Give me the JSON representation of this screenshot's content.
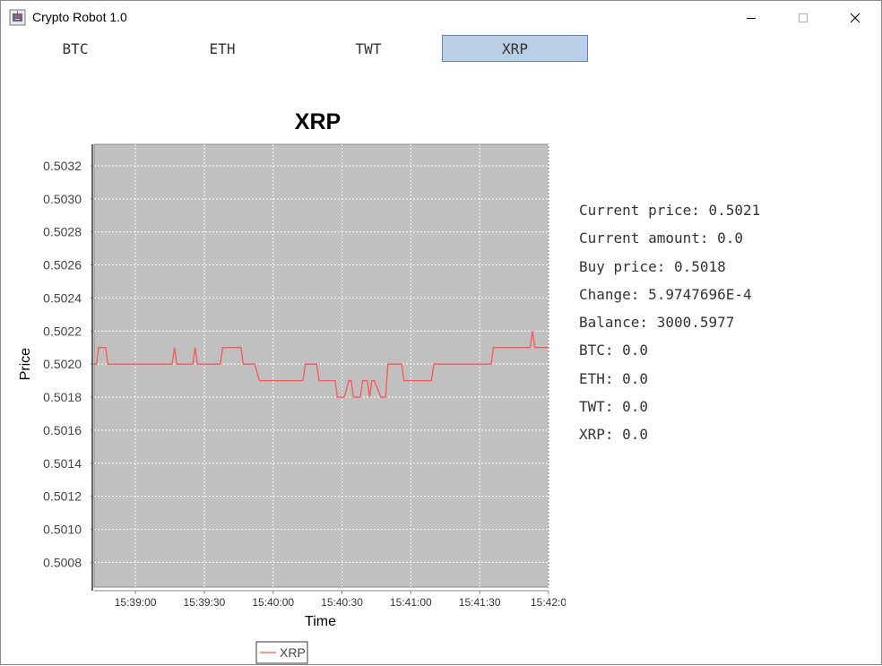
{
  "window": {
    "title": "Crypto Robot 1.0",
    "icon": "robot-app-icon",
    "controls": [
      "minimize-icon",
      "maximize-icon",
      "close-icon"
    ]
  },
  "tabs": [
    {
      "label": "BTC",
      "selected": false
    },
    {
      "label": "ETH",
      "selected": false
    },
    {
      "label": "TWT",
      "selected": false
    },
    {
      "label": "XRP",
      "selected": true
    }
  ],
  "info": {
    "current_price": "Current price: 0.5021",
    "current_amount": "Current amount: 0.0",
    "buy_price": "Buy price: 0.5018",
    "change": "Change: 5.9747696E-4",
    "balance": "Balance: 3000.5977",
    "btc": "BTC: 0.0",
    "eth": "ETH: 0.0",
    "twt": "TWT: 0.0",
    "xrp": "XRP: 0.0"
  },
  "colors": {
    "accent_tab_bg": "#b8cfe5",
    "accent_tab_border": "#6382bf",
    "plot_bg": "#c0c0c0",
    "series_line": "#ff5555"
  },
  "chart_data": {
    "type": "line",
    "title": "XRP",
    "xlabel": "Time",
    "ylabel": "Price",
    "ylim": [
      0.50065,
      0.50333
    ],
    "yticks": [
      "0.5032",
      "0.5030",
      "0.5028",
      "0.5026",
      "0.5024",
      "0.5022",
      "0.5020",
      "0.5018",
      "0.5016",
      "0.5014",
      "0.5012",
      "0.5010",
      "0.5008"
    ],
    "xticks": [
      "15:39:00",
      "15:39:30",
      "15:40:00",
      "15:40:30",
      "15:41:00",
      "15:41:30",
      "15:42:0"
    ],
    "x_tick_seconds": [
      0,
      30,
      60,
      90,
      120,
      150,
      180
    ],
    "xlim_seconds": [
      -18,
      180
    ],
    "grid": true,
    "legend": "bottom",
    "series": [
      {
        "name": "XRP",
        "x_seconds": [
          -18,
          -17,
          -16,
          -14,
          -13,
          -12,
          -6,
          0,
          6,
          15,
          16,
          17,
          18,
          22,
          25,
          26,
          27,
          36,
          37,
          38,
          42,
          46,
          47,
          51,
          52,
          54,
          55,
          62,
          63,
          73,
          74,
          79,
          80,
          83,
          84,
          87,
          88,
          89,
          90,
          91,
          93,
          94,
          95,
          97,
          98,
          99,
          100,
          101,
          102,
          103,
          104,
          107,
          108,
          109,
          110,
          111,
          116,
          117,
          122,
          124,
          129,
          130,
          136,
          140,
          150,
          155,
          156,
          168,
          172,
          173,
          174,
          175,
          180
        ],
        "values": [
          0.502,
          0.502,
          0.5021,
          0.5021,
          0.5021,
          0.502,
          0.502,
          0.502,
          0.502,
          0.502,
          0.502,
          0.5021,
          0.502,
          0.502,
          0.502,
          0.5021,
          0.502,
          0.502,
          0.502,
          0.5021,
          0.5021,
          0.5021,
          0.502,
          0.502,
          0.502,
          0.5019,
          0.5019,
          0.5019,
          0.5019,
          0.5019,
          0.502,
          0.502,
          0.5019,
          0.5019,
          0.5019,
          0.5019,
          0.5018,
          0.5018,
          0.5018,
          0.5018,
          0.5019,
          0.5019,
          0.5018,
          0.5018,
          0.5018,
          0.5019,
          0.5019,
          0.5019,
          0.5018,
          0.5019,
          0.5019,
          0.5018,
          0.5018,
          0.5018,
          0.502,
          0.502,
          0.502,
          0.5019,
          0.5019,
          0.5019,
          0.5019,
          0.502,
          0.502,
          0.502,
          0.502,
          0.502,
          0.5021,
          0.5021,
          0.5021,
          0.5022,
          0.5021,
          0.5021,
          0.5021
        ]
      }
    ]
  }
}
